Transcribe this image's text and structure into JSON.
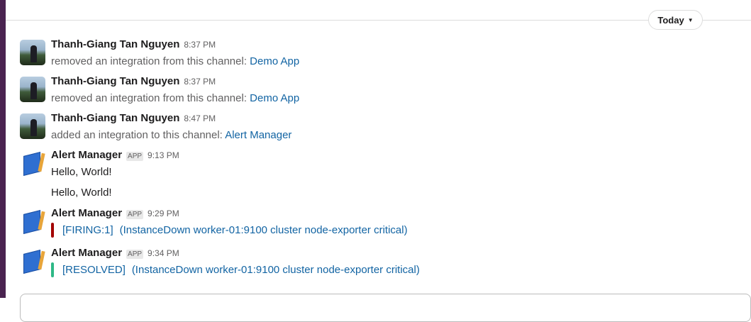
{
  "date_divider": {
    "label": "Today"
  },
  "messages": [
    {
      "author": "Thanh-Giang Tan Nguyen",
      "time": "8:37 PM",
      "text": "removed an integration from this channel:",
      "link": "Demo App"
    },
    {
      "author": "Thanh-Giang Tan Nguyen",
      "time": "8:37 PM",
      "text": "removed an integration from this channel:",
      "link": "Demo App"
    },
    {
      "author": "Thanh-Giang Tan Nguyen",
      "time": "8:47 PM",
      "text": "added an integration to this channel:",
      "link": "Alert Manager"
    },
    {
      "author": "Alert Manager",
      "badge": "APP",
      "time": "9:13 PM",
      "lines": [
        "Hello, World!",
        "Hello, World!"
      ]
    },
    {
      "author": "Alert Manager",
      "badge": "APP",
      "time": "9:29 PM",
      "status": "[FIRING:1]",
      "detail": "(InstanceDown worker-01:9100 cluster node-exporter critical)",
      "color": "#a30200"
    },
    {
      "author": "Alert Manager",
      "badge": "APP",
      "time": "9:34 PM",
      "status": "[RESOLVED]",
      "detail": "(InstanceDown worker-01:9100 cluster node-exporter critical)",
      "color": "#2eb886"
    }
  ]
}
